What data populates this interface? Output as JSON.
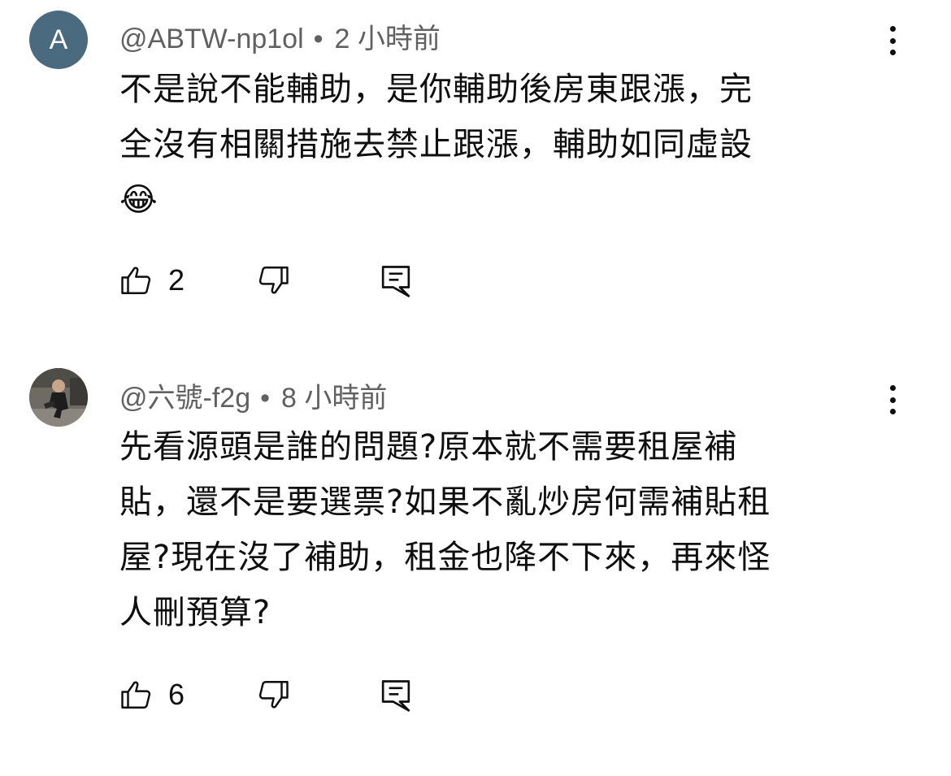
{
  "comments": [
    {
      "avatar_letter": "A",
      "author": "@ABTW-np1ol",
      "separator": "•",
      "time": "2 小時前",
      "lines": [
        "不是說不能輔助，是你輔助後房東跟漲，完",
        "全沒有相關措施去禁止跟漲，輔助如同虛設"
      ],
      "emoji": "😂",
      "likes": "2"
    },
    {
      "author": "@六號-f2g",
      "separator": "•",
      "time": "8 小時前",
      "lines": [
        "先看源頭是誰的問題?原本就不需要租屋補",
        "貼，還不是要選票?如果不亂炒房何需補貼租",
        "屋?現在沒了補助，租金也降不下來，再來怪",
        "人刪預算?"
      ],
      "likes": "6"
    }
  ],
  "icons": {
    "like": "thumbs-up-icon",
    "dislike": "thumbs-down-icon",
    "reply": "reply-comment-icon",
    "menu": "more-vertical-icon"
  },
  "colors": {
    "avatar_bg": "#4a6a80",
    "meta_text": "#606060",
    "text": "#0f0f0f"
  }
}
